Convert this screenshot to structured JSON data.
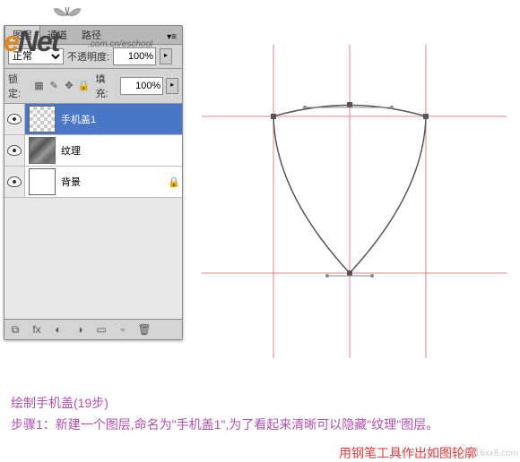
{
  "logo": {
    "main_e": "e",
    "main_net": "Net",
    "sub": ".com.cn/eschool"
  },
  "panel": {
    "tabs": [
      "图层",
      "通道",
      "路径"
    ],
    "tabs_menu": "▾≡",
    "blend_mode": "正常",
    "opacity_label": "不透明度:",
    "opacity_value": "100%",
    "lock_label": "锁定:",
    "fill_label": "填充:",
    "fill_value": "100%"
  },
  "layers": [
    {
      "name": "手机盖1",
      "visible": true,
      "selected": true,
      "thumb": "trans",
      "locked": false
    },
    {
      "name": "纹理",
      "visible": true,
      "selected": false,
      "thumb": "texture",
      "locked": false
    },
    {
      "name": "背景",
      "visible": true,
      "selected": false,
      "thumb": "white",
      "locked": true
    }
  ],
  "instructions": {
    "title": "绘制手机盖(19步)",
    "step1": "步骤1：新建一个图层,命名为\"手机盖1\",为了看起来清晰可以隐藏\"纹理\"图层。",
    "hint": "用钢笔工具作出如图轮廓"
  },
  "watermark": "最好的PS论坛—bbs.16xx8.com"
}
